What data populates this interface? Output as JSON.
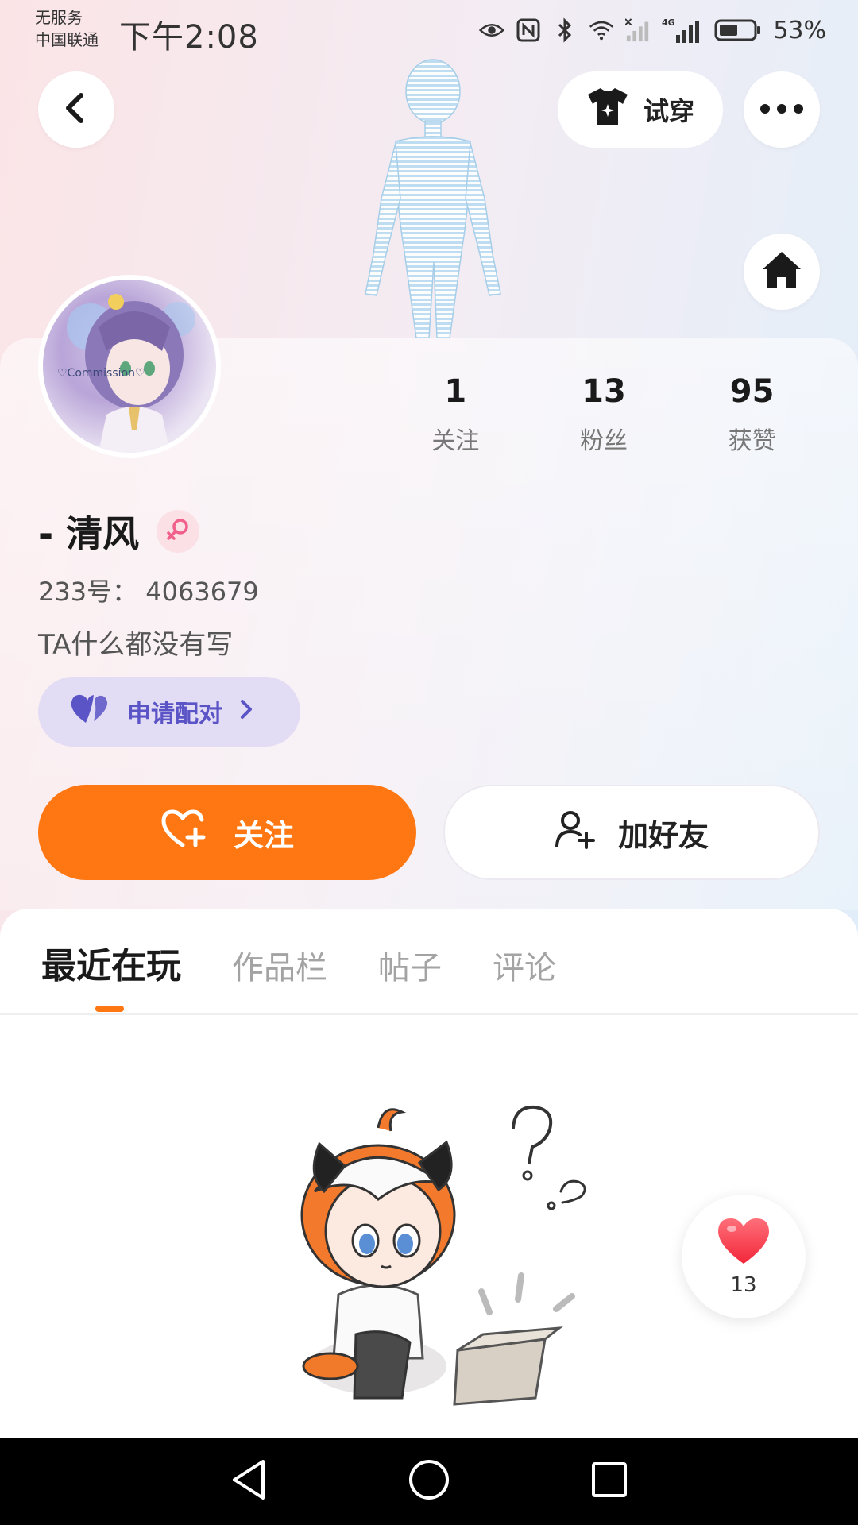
{
  "status_bar": {
    "carrier_line1": "无服务",
    "carrier_line2": "中国联通",
    "time": "下午2:08",
    "network": "4G",
    "battery": "53%"
  },
  "header": {
    "tryon_label": "试穿"
  },
  "profile": {
    "username": "- 清风",
    "uid": "233号： 4063679",
    "bio": "TA什么都没有写",
    "stats": [
      {
        "value": "1",
        "label": "关注"
      },
      {
        "value": "13",
        "label": "粉丝"
      },
      {
        "value": "95",
        "label": "获赞"
      }
    ],
    "avatar_text": "♡Commission♡"
  },
  "actions": {
    "match_label": "申请配对",
    "follow_label": "关注",
    "add_friend_label": "加好友"
  },
  "tabs": [
    {
      "label": "最近在玩",
      "active": true
    },
    {
      "label": "作品栏",
      "active": false
    },
    {
      "label": "帖子",
      "active": false
    },
    {
      "label": "评论",
      "active": false
    }
  ],
  "like_float": {
    "count": "13"
  },
  "colors": {
    "accent": "#ff7712",
    "match_bg": "#e2dcf4",
    "match_text": "#5b54c6",
    "gender": "#f0608a"
  },
  "icons": {
    "back": "chevron-left-icon",
    "more": "more-dots-icon",
    "home": "home-icon",
    "tryon": "shirt-icon",
    "gender": "female-icon",
    "match": "heart-pair-icon",
    "follow": "heart-plus-icon",
    "friend": "user-plus-icon",
    "like": "heart-icon"
  }
}
